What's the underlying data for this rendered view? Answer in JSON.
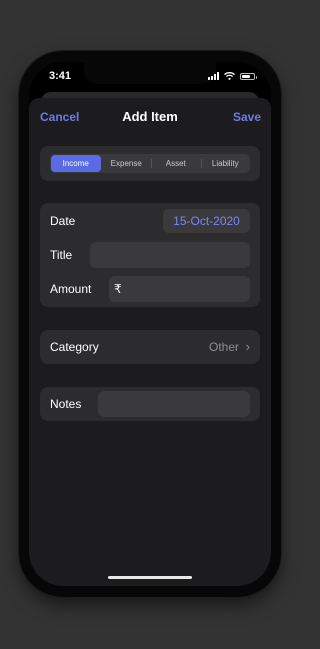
{
  "status_bar": {
    "time": "3:41",
    "battery_level": 0.7
  },
  "nav": {
    "cancel": "Cancel",
    "title": "Add Item",
    "save": "Save"
  },
  "segments": [
    "Income",
    "Expense",
    "Asset",
    "Liability"
  ],
  "selected_segment": "Income",
  "form": {
    "date_label": "Date",
    "date_value": "15-Oct-2020",
    "title_label": "Title",
    "title_value": "",
    "amount_label": "Amount",
    "currency_symbol": "₹",
    "amount_value": ""
  },
  "category": {
    "label": "Category",
    "value": "Other",
    "chevron": "chevron-right-icon"
  },
  "notes": {
    "label": "Notes",
    "value": ""
  },
  "colors": {
    "accent": "#6e79ea",
    "segment_active": "#5b6ae6",
    "background": "#333333",
    "sheet": "#1c1c1e",
    "group": "#2c2c2e"
  }
}
